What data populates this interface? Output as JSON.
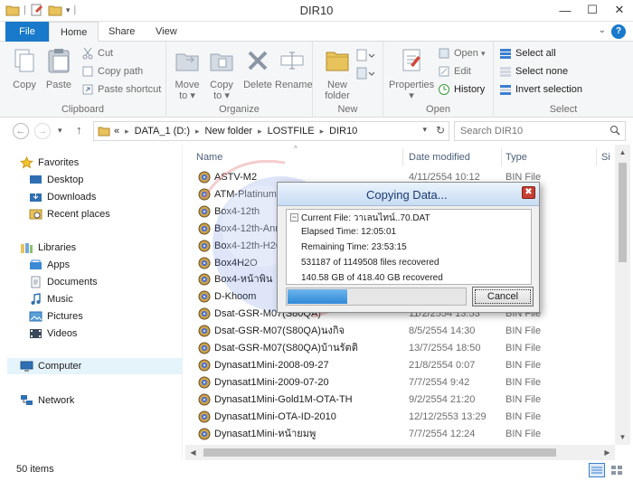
{
  "window": {
    "title": "DIR10"
  },
  "ribbon": {
    "tabs": [
      "File",
      "Home",
      "Share",
      "View"
    ],
    "clipboard": {
      "copy": "Copy",
      "paste": "Paste",
      "cut": "Cut",
      "copy_path": "Copy path",
      "paste_shortcut": "Paste shortcut",
      "label": "Clipboard"
    },
    "organize": {
      "move_to": [
        "Move",
        "to ▾"
      ],
      "copy_to": [
        "Copy",
        "to ▾"
      ],
      "delete": "Delete",
      "rename": "Rename",
      "label": "Organize"
    },
    "new": {
      "new_folder": [
        "New",
        "folder"
      ],
      "label": "New"
    },
    "open": {
      "properties": "Properties",
      "open": "Open",
      "edit": "Edit",
      "history": "History",
      "label": "Open"
    },
    "select": {
      "select_all": "Select all",
      "select_none": "Select none",
      "invert": "Invert selection",
      "label": "Select"
    }
  },
  "address": {
    "crumbs": [
      "«",
      "DATA_1 (D:)",
      "New folder",
      "LOSTFILE",
      "DIR10"
    ],
    "search_placeholder": "Search DIR10"
  },
  "navpane": {
    "favorites": "Favorites",
    "desktop": "Desktop",
    "downloads": "Downloads",
    "recent": "Recent places",
    "libraries": "Libraries",
    "apps": "Apps",
    "documents": "Documents",
    "music": "Music",
    "pictures": "Pictures",
    "videos": "Videos",
    "computer": "Computer",
    "network": "Network"
  },
  "columns": {
    "name": "Name",
    "date": "Date modified",
    "type": "Type",
    "size": "Si"
  },
  "files": [
    {
      "name": "ASTV-M2",
      "date": "4/11/2554 10:12",
      "type": "BIN File"
    },
    {
      "name": "ATM-Platinum",
      "date": "",
      "type": ""
    },
    {
      "name": "Box4-12th",
      "date": "",
      "type": ""
    },
    {
      "name": "Box4-12th-Ann",
      "date": "",
      "type": ""
    },
    {
      "name": "Box4-12th-H20",
      "date": "",
      "type": ""
    },
    {
      "name": "Box4H2O",
      "date": "",
      "type": ""
    },
    {
      "name": "Box4-หน้าพิน",
      "date": "",
      "type": ""
    },
    {
      "name": "D-Khoom",
      "date": "",
      "type": ""
    },
    {
      "name": "Dsat-GSR-M07(S80QA)",
      "date": "11/2/2554 13:53",
      "type": "BIN File"
    },
    {
      "name": "Dsat-GSR-M07(S80QA)นงกิจ",
      "date": "8/5/2554 14:30",
      "type": "BIN File"
    },
    {
      "name": "Dsat-GSR-M07(S80QA)บ้านรัตติ",
      "date": "13/7/2554 18:50",
      "type": "BIN File"
    },
    {
      "name": "Dynasat1Mini-2008-09-27",
      "date": "21/8/2554 0:07",
      "type": "BIN File"
    },
    {
      "name": "Dynasat1Mini-2009-07-20",
      "date": "7/7/2554 9:42",
      "type": "BIN File"
    },
    {
      "name": "Dynasat1Mini-Gold1M-OTA-TH",
      "date": "9/2/2554 21:20",
      "type": "BIN File"
    },
    {
      "name": "Dynasat1Mini-OTA-ID-2010",
      "date": "12/12/2553 13:29",
      "type": "BIN File"
    },
    {
      "name": "Dynasat1Mini-หน้ายมพู",
      "date": "7/7/2554 12:24",
      "type": "BIN File"
    }
  ],
  "status": {
    "items": "50 items"
  },
  "dialog": {
    "title": "Copying Data...",
    "current_file": "Current File: วาเลนไทน์..70.DAT",
    "elapsed": "Elapsed Time: 12:05:01",
    "remaining": "Remaining Time: 23:53:15",
    "files_recovered": "531187 of 1149508 files recovered",
    "gb_recovered": "140.58 GB of 418.40 GB recovered",
    "progress_fraction": 0.336,
    "cancel": "Cancel",
    "close_glyph": "✖"
  },
  "colors": {
    "accent": "#1979ca",
    "progress": "#2f8ad8",
    "close": "#c93f33"
  }
}
